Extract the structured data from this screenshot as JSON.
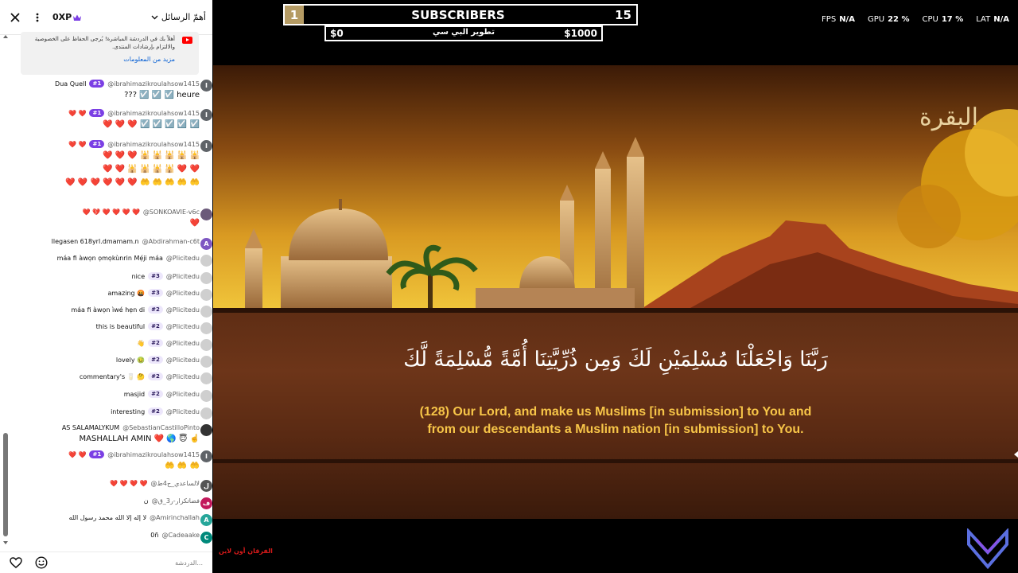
{
  "chat": {
    "header": {
      "xp": "0XP",
      "mode": "أهمّ الرسائل"
    },
    "notice": {
      "text": "أهلاً بك في الدردشة المباشرة! يُرجى الحفاظ على الخصوصية والالتزام بإرشادات المنتدى.",
      "link": "مزيد من المعلومات"
    },
    "messages": [
      {
        "avatar": "I",
        "avatar_color": "#5f6368",
        "author": "@ibrahimazikroulahsow1415",
        "badge": "#1",
        "text": "Dua Quell",
        "line2": "??? ☑️ ☑️ ☑️ heure"
      },
      {
        "avatar": "I",
        "avatar_color": "#5f6368",
        "author": "@ibrahimazikroulahsow1415",
        "badge": "#1",
        "text": "❤️ ❤️",
        "line2": "❤️ ❤️ ❤️ ☑️ ☑️ ☑️ ☑️ ☑️"
      },
      {
        "avatar": "I",
        "avatar_color": "#5f6368",
        "author": "@ibrahimazikroulahsow1415",
        "badge": "#1",
        "text": "❤️ ❤️",
        "line2": "❤️ ❤️ ❤️ 🕌 🕌 🕌 🕌 🕌",
        "line3": "❤️ ❤️ 🕌 🕌 🕌 🕌 ❤️ ❤️",
        "line4": "❤️ ❤️ ❤️ ❤️ ❤️ ❤️ 🤲 🤲 🤲 🤲 🤲"
      },
      {
        "avatar": "",
        "avatar_color": "#6b5a7a",
        "author": "@SONKOAVIE-v6c",
        "badge": "",
        "text": "❤️ 💔 ❤️ ❤️ ❤️ ❤️",
        "line2": "❤️"
      },
      {
        "avatar": "A",
        "avatar_color": "#7e57c2",
        "author": "@Abdirahman-c6t",
        "badge": "",
        "text": "llegasen 618yrl.dmamam.n"
      },
      {
        "avatar": "",
        "avatar_color": "#cfcfcf",
        "author": "@Plicitedu",
        "badge": "",
        "text": "máa fi àwọn ọmọkùnrin Mẹ́ji máa"
      },
      {
        "avatar": "",
        "avatar_color": "#cfcfcf",
        "author": "@Plicitedu",
        "badge": "#3",
        "text": "nice"
      },
      {
        "avatar": "",
        "avatar_color": "#cfcfcf",
        "author": "@Plicitedu",
        "badge": "#3",
        "text": "amazing 🤬"
      },
      {
        "avatar": "",
        "avatar_color": "#cfcfcf",
        "author": "@Plicitedu",
        "badge": "#2",
        "text": "máa fi àwọn ìwé hẹn di"
      },
      {
        "avatar": "",
        "avatar_color": "#cfcfcf",
        "author": "@Plicitedu",
        "badge": "#2",
        "text": "this is beautiful"
      },
      {
        "avatar": "",
        "avatar_color": "#cfcfcf",
        "author": "@Plicitedu",
        "badge": "#2",
        "text": "👋"
      },
      {
        "avatar": "",
        "avatar_color": "#cfcfcf",
        "author": "@Plicitedu",
        "badge": "#2",
        "text": "lovely 🤢"
      },
      {
        "avatar": "",
        "avatar_color": "#cfcfcf",
        "author": "@Plicitedu",
        "badge": "#2",
        "text": "commentary's 🥛 🤔"
      },
      {
        "avatar": "",
        "avatar_color": "#cfcfcf",
        "author": "@Plicitedu",
        "badge": "#2",
        "text": "masjid"
      },
      {
        "avatar": "",
        "avatar_color": "#cfcfcf",
        "author": "@Plicitedu",
        "badge": "#2",
        "text": "interesting"
      },
      {
        "avatar": "",
        "avatar_color": "#333333",
        "author": "@SebastianCastilloPinto",
        "badge": "",
        "text": "AS SALAMALYKUM",
        "line2": "MASHALLAH AMIN ❤️ 🌎 😇 ☝️"
      },
      {
        "avatar": "I",
        "avatar_color": "#5f6368",
        "author": "@ibrahimazikroulahsow1415",
        "badge": "#1",
        "text": "❤️ ❤️",
        "line2": "🤲 🤲 🤲"
      },
      {
        "avatar": "ل",
        "avatar_color": "#555555",
        "author": "@لالساعدي_ح4ط",
        "badge": "",
        "text": "❤️ ❤️ ❤️ ❤️"
      },
      {
        "avatar": "ف",
        "avatar_color": "#c2185b",
        "author": "@فضاتكرار-ر3_ق",
        "badge": "",
        "text": "ن"
      },
      {
        "avatar": "A",
        "avatar_color": "#26a69a",
        "author": "@Amirinchallah",
        "badge": "",
        "text": "لا إله إلا الله محمد رسول الله"
      },
      {
        "avatar": "C",
        "avatar_color": "#00897b",
        "author": "@Cadeaake",
        "badge": "",
        "text": "0ñ"
      }
    ],
    "input": {
      "placeholder": "الدردشة..."
    }
  },
  "hud": {
    "subscribers": {
      "rank": "1",
      "title": "SUBSCRIBERS",
      "count": "15"
    },
    "goal": {
      "current": "$0",
      "label": "تطوير البي سي",
      "target": "$1000"
    },
    "stats": [
      {
        "label": "FPS",
        "value": "N/A"
      },
      {
        "label": "GPU",
        "value": "22 %"
      },
      {
        "label": "CPU",
        "value": "17 %"
      },
      {
        "label": "LAT",
        "value": "N/A"
      }
    ]
  },
  "video": {
    "surah_title": "البقرة",
    "arabic_verse": "رَبَّنَا وَاجْعَلْنَا مُسْلِمَيْنِ لَكَ وَمِن ذُرِّيَّتِنَا أُمَّةً مُّسْلِمَةً لَّكَ",
    "translation_line1": "(128) Our Lord, and make us Muslims [in submission] to You and",
    "translation_line2": "from our descendants a Muslim nation [in submission] to You.",
    "channel_logo": "الفرقان أون لاين"
  },
  "colors": {
    "badge_purple": "#7b3fe4",
    "subscriber_rank_bg": "#b59b64",
    "translation_gold": "#f7c548",
    "scroll_brown": "#5e2d14"
  }
}
